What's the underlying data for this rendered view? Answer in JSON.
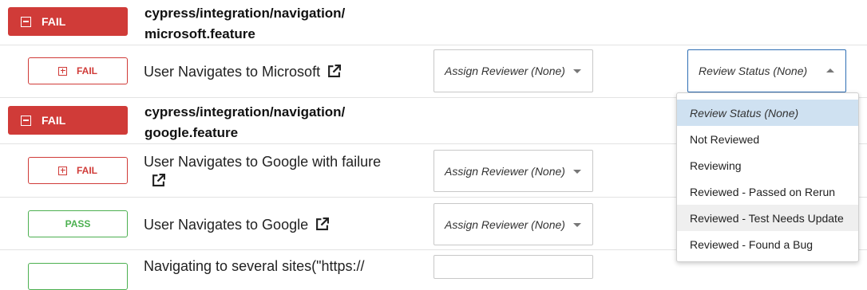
{
  "features": [
    {
      "status": "FAIL",
      "title_line1": "cypress/integration/navigation/",
      "title_line2": "microsoft.feature"
    },
    {
      "status": "FAIL",
      "title_line1": "cypress/integration/navigation/",
      "title_line2": "google.feature"
    }
  ],
  "scenarios": [
    {
      "status": "FAIL",
      "line1": "User Navigates to Microsoft",
      "reviewer": "Assign Reviewer (None)",
      "review_status": "Review Status (None)"
    },
    {
      "status": "FAIL",
      "line1": "User Navigates to Google with failure",
      "reviewer": "Assign Reviewer (None)"
    },
    {
      "status": "PASS",
      "line1": "User Navigates to Google",
      "reviewer": "Assign Reviewer (None)"
    },
    {
      "line1": "Navigating to several sites(\"https://"
    }
  ],
  "review_status_dropdown": {
    "options": [
      "Review Status (None)",
      "Not Reviewed",
      "Reviewing",
      "Reviewed - Passed on Rerun",
      "Reviewed - Test Needs Update",
      "Reviewed - Found a Bug"
    ],
    "selected": "Review Status (None)",
    "hovered": "Reviewed - Test Needs Update"
  },
  "icons": {
    "collapse": "minus-square-icon",
    "expand": "plus-square-icon",
    "external_link": "external-link-icon",
    "dropdown": "caret-down-icon"
  },
  "colors": {
    "fail": "#d03b38",
    "pass": "#4cb050",
    "focus": "#2f6fb4",
    "selected_option": "#cfe1f1"
  }
}
